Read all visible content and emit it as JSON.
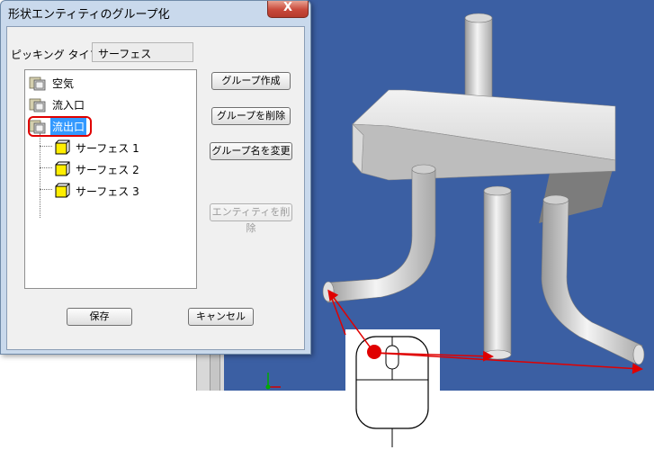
{
  "dialog": {
    "title": "形状エンティティのグループ化",
    "close_label": "X",
    "picking_type_label": "ピッキング タイプ",
    "picking_type_value": "サーフェス",
    "tree": {
      "groups": [
        {
          "label": "空気",
          "selected": false
        },
        {
          "label": "流入口",
          "selected": false
        },
        {
          "label": "流出口",
          "selected": true
        }
      ],
      "children": [
        "サーフェス 1",
        "サーフェス 2",
        "サーフェス 3"
      ]
    },
    "buttons": {
      "create_group": "グループ作成",
      "delete_group": "グループを削除",
      "rename_group": "グループ名を変更",
      "delete_entity": "エンティティを削除",
      "save": "保存",
      "cancel": "キャンセル"
    }
  },
  "colors": {
    "viewport_bg": "#3b5fa3",
    "selection": "#3399ff",
    "highlight": "#e00000"
  }
}
